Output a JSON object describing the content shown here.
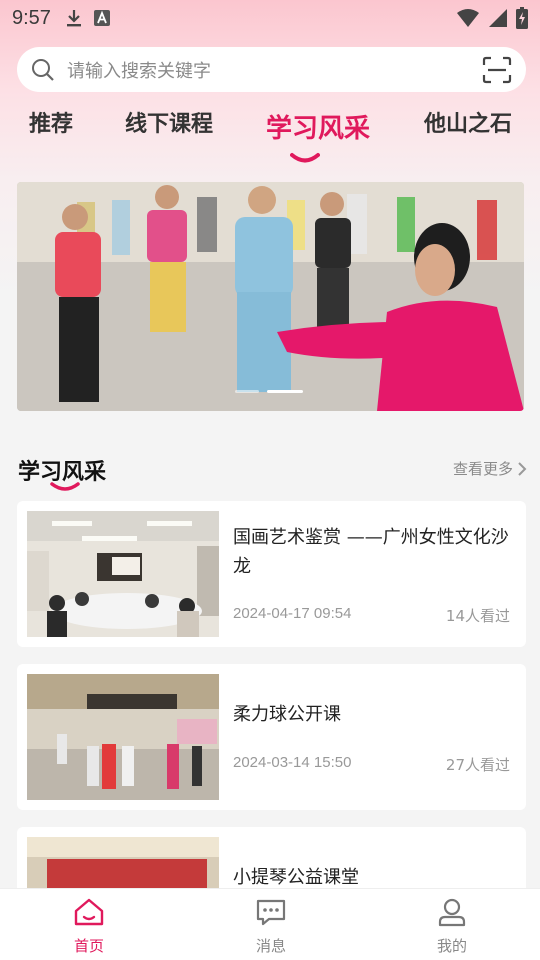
{
  "status_bar": {
    "time": "9:57"
  },
  "search": {
    "placeholder": "请输入搜索关键字"
  },
  "tabs": [
    {
      "label": "推荐"
    },
    {
      "label": "线下课程"
    },
    {
      "label": "学习风采"
    },
    {
      "label": "他山之石"
    }
  ],
  "active_tab": "学习风采",
  "banner": {
    "slides": 2,
    "active_slide": 2
  },
  "section": {
    "title": "学习风采",
    "more_label": "查看更多"
  },
  "articles": [
    {
      "title": "国画艺术鉴赏 ——广州女性文化沙龙",
      "date": "2024-04-17 09:54",
      "views": "14人看过"
    },
    {
      "title": "柔力球公开课",
      "date": "2024-03-14 15:50",
      "views": "27人看过"
    },
    {
      "title": "小提琴公益课堂",
      "date": "",
      "views": ""
    }
  ],
  "nav": [
    {
      "label": "首页",
      "icon": "home-icon"
    },
    {
      "label": "消息",
      "icon": "message-icon"
    },
    {
      "label": "我的",
      "icon": "profile-icon"
    }
  ],
  "colors": {
    "accent": "#e0195c",
    "background": "#f4f4f4"
  }
}
